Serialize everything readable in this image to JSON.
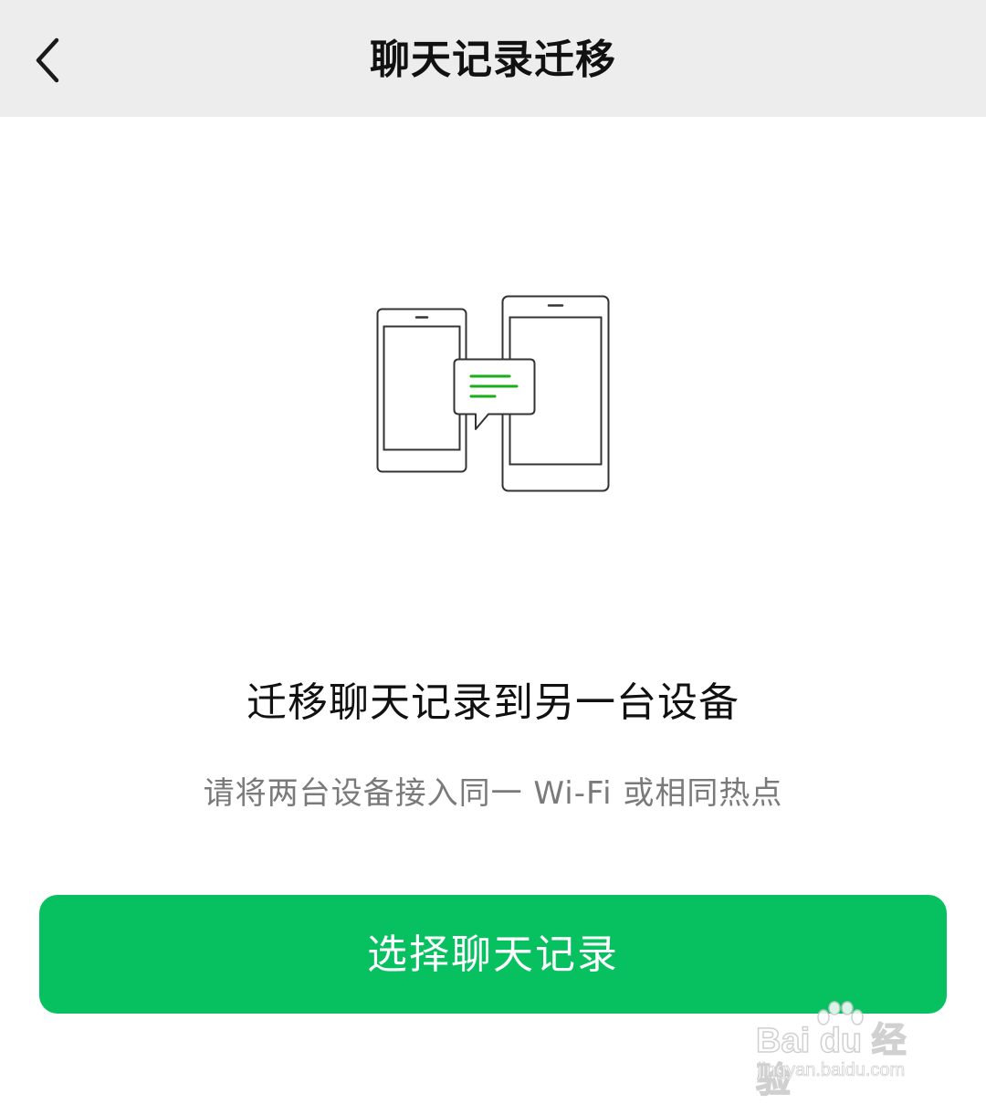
{
  "header": {
    "back_icon": "chevron-left-icon",
    "title": "聊天记录迁移"
  },
  "illustration": {
    "icon": "phone-to-tablet-chat-transfer-illustration",
    "accent_color": "#1aad19",
    "stroke_color": "#333333"
  },
  "main": {
    "headline": "迁移聊天记录到另一台设备",
    "subtitle": "请将两台设备接入同一 Wi-Fi 或相同热点"
  },
  "actions": {
    "select_label": "选择聊天记录",
    "button_color": "#07c160"
  },
  "watermark": {
    "logo_text": "Bai du 经验",
    "url": "jingyan.baidu.com"
  }
}
